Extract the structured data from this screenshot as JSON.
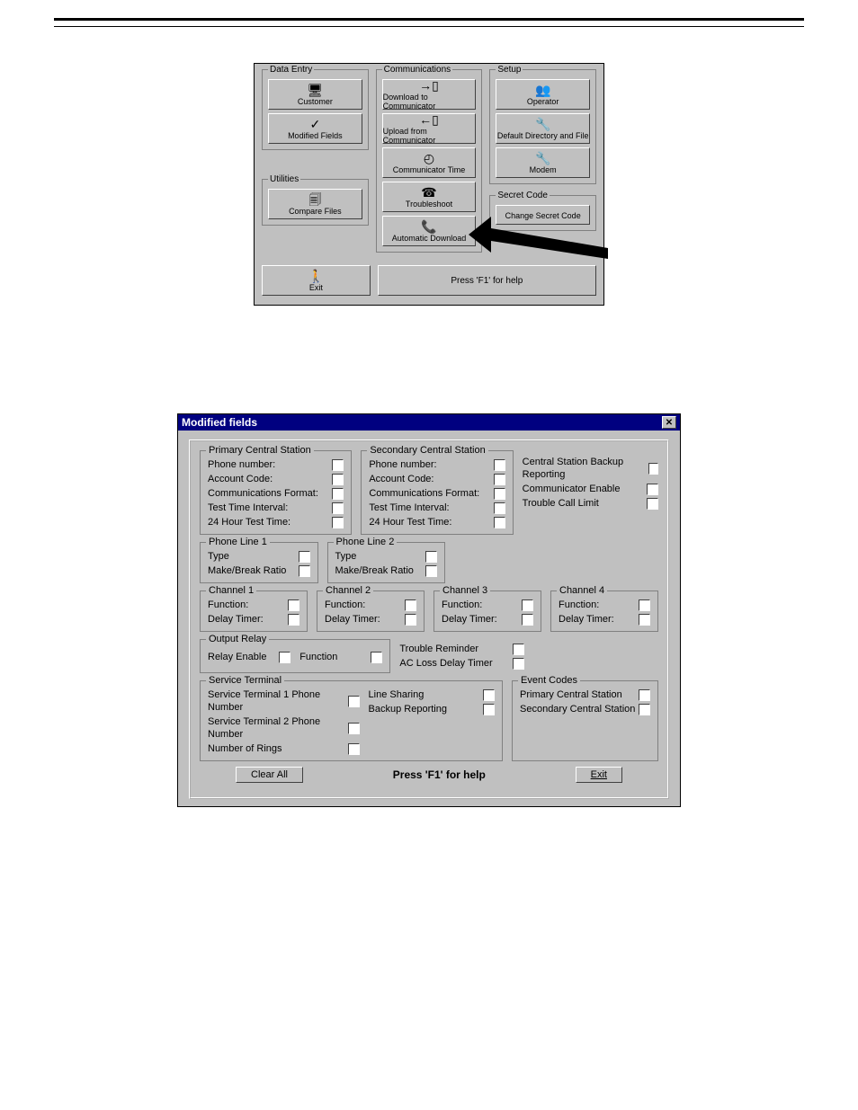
{
  "menu": {
    "columns": [
      {
        "legend": "Data Entry",
        "buttons": [
          {
            "name": "customer-button",
            "icon": "🖥",
            "label": "Customer"
          },
          {
            "name": "modified-fields-button",
            "icon": "✓",
            "label": "Modified Fields"
          }
        ]
      },
      {
        "legend": "Communications",
        "buttons": [
          {
            "name": "download-to-communicator-button",
            "icon": "→▯",
            "label": "Download to Communicator"
          },
          {
            "name": "upload-from-communicator-button",
            "icon": "←▯",
            "label": "Upload from Communicator"
          },
          {
            "name": "communicator-time-button",
            "icon": "◴",
            "label": "Communicator Time"
          },
          {
            "name": "troubleshoot-button",
            "icon": "☎",
            "label": "Troubleshoot"
          },
          {
            "name": "automatic-download-button",
            "icon": "📞",
            "label": "Automatic Download"
          }
        ]
      },
      {
        "legend": "Setup",
        "buttons": [
          {
            "name": "operator-button",
            "icon": "👥",
            "label": "Operator"
          },
          {
            "name": "default-directory-file-button",
            "icon": "🔧",
            "label": "Default Directory and File"
          },
          {
            "name": "modem-button",
            "icon": "🔧",
            "label": "Modem"
          }
        ]
      }
    ],
    "utilities_legend": "Utilities",
    "compare_files_label": "Compare Files",
    "secret_code_legend": "Secret Code",
    "change_secret_code_label": "Change Secret Code",
    "exit_label": "Exit",
    "help_text": "Press 'F1' for help"
  },
  "dialog": {
    "title": "Modified fields",
    "primary": {
      "legend": "Primary Central Station",
      "fields": [
        "Phone number:",
        "Account Code:",
        "Communications Format:",
        "Test Time Interval:",
        "24 Hour Test Time:"
      ]
    },
    "secondary": {
      "legend": "Secondary Central Station",
      "fields": [
        "Phone number:",
        "Account Code:",
        "Communications Format:",
        "Test Time Interval:",
        "24 Hour Test Time:"
      ]
    },
    "misc1": [
      "Central Station Backup Reporting",
      "Communicator Enable",
      "Trouble Call Limit"
    ],
    "phone_line1": {
      "legend": "Phone Line 1",
      "fields": [
        "Type",
        "Make/Break Ratio"
      ]
    },
    "phone_line2": {
      "legend": "Phone Line 2",
      "fields": [
        "Type",
        "Make/Break Ratio"
      ]
    },
    "channels": [
      {
        "legend": "Channel 1",
        "fields": [
          "Function:",
          "Delay Timer:"
        ]
      },
      {
        "legend": "Channel 2",
        "fields": [
          "Function:",
          "Delay Timer:"
        ]
      },
      {
        "legend": "Channel 3",
        "fields": [
          "Function:",
          "Delay Timer:"
        ]
      },
      {
        "legend": "Channel 4",
        "fields": [
          "Function:",
          "Delay Timer:"
        ]
      }
    ],
    "output_relay": {
      "legend": "Output Relay",
      "fields": [
        "Relay Enable",
        "Function"
      ]
    },
    "misc2": [
      "Trouble Reminder",
      "AC Loss Delay Timer"
    ],
    "service_terminal": {
      "legend": "Service Terminal",
      "left": [
        "Service Terminal 1 Phone Number",
        "Service Terminal 2 Phone Number",
        "Number of Rings"
      ],
      "right": [
        "Line Sharing",
        "Backup Reporting"
      ]
    },
    "event_codes": {
      "legend": "Event Codes",
      "fields": [
        "Primary Central Station",
        "Secondary Central Station"
      ]
    },
    "clear_all": "Clear All",
    "help_text": "Press 'F1' for help",
    "exit": "Exit"
  }
}
